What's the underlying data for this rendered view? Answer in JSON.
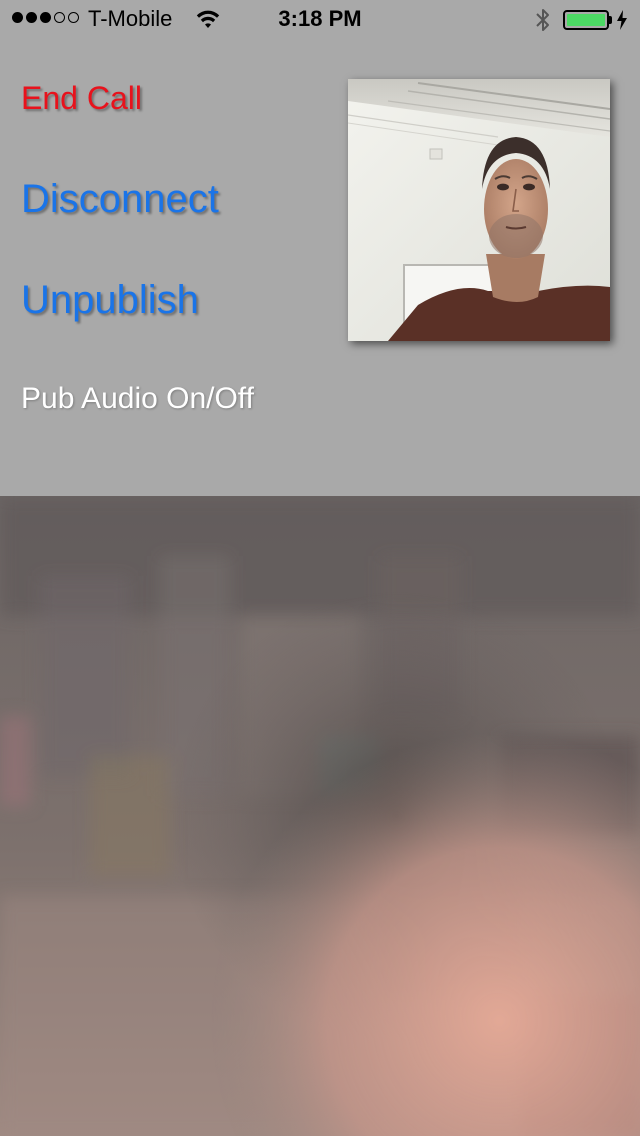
{
  "status_bar": {
    "signal_bars_filled": 3,
    "signal_bars_total": 5,
    "carrier": "T-Mobile",
    "wifi_icon": "wifi-icon",
    "time": "3:18 PM",
    "bluetooth_icon": "bluetooth-icon",
    "battery_level": 1.0,
    "battery_color": "#4cd964",
    "charging_icon": "charging-bolt-icon"
  },
  "controls": {
    "end_call": "End Call",
    "disconnect": "Disconnect",
    "unpublish": "Unpublish",
    "pub_audio": "Pub Audio On/Off"
  },
  "colors": {
    "background": "#a9a9a9",
    "end_call": "#e8121c",
    "link": "#1a74e8",
    "pub_audio": "#ffffff"
  },
  "publisher_view": {
    "icon": "publisher-camera-preview"
  },
  "subscriber_view": {
    "icon": "subscriber-video-stream"
  }
}
